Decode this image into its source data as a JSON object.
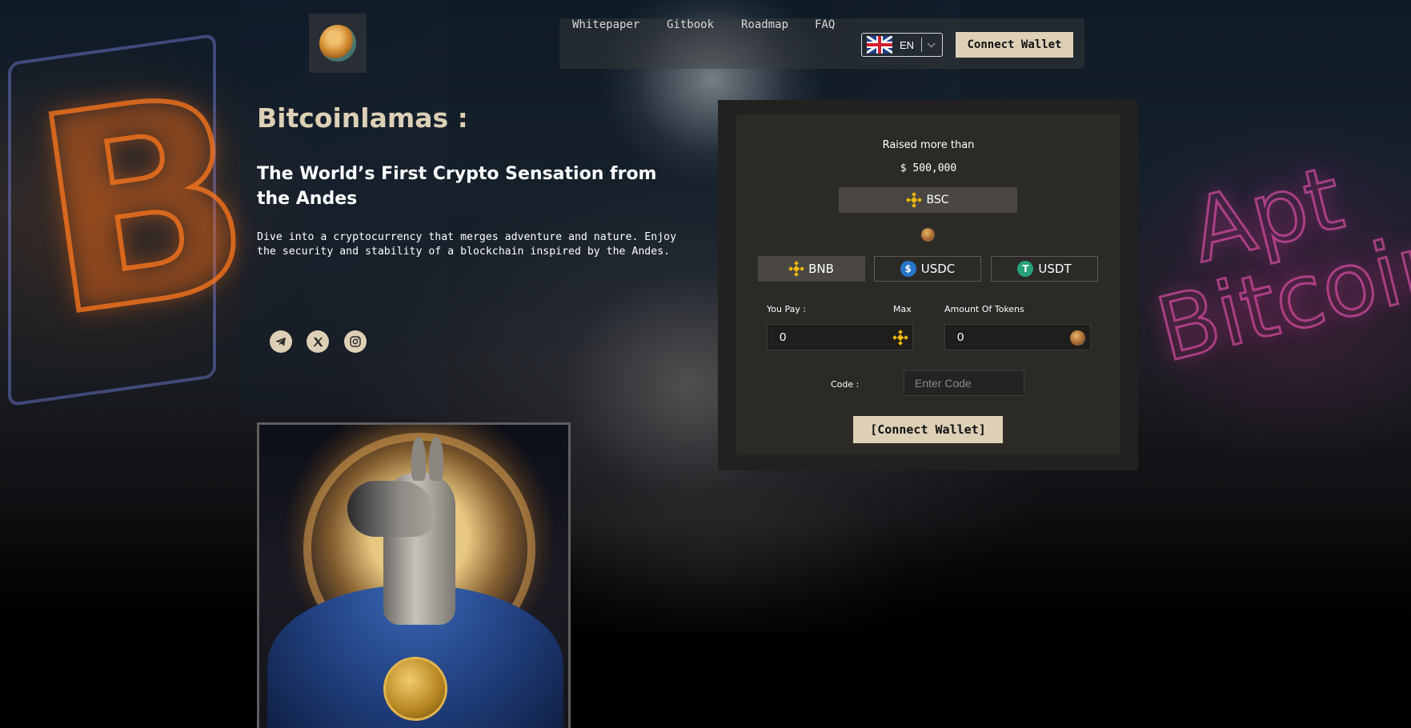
{
  "header": {
    "logo_alt": "Bitcoinlamas logo",
    "nav": [
      "Whitepaper",
      "Gitbook",
      "Roadmap",
      "FAQ"
    ],
    "language": "EN",
    "connect_label": "Connect Wallet"
  },
  "hero": {
    "title": "Bitcoinlamas :",
    "subtitle": "The World’s First Crypto Sensation from the Andes",
    "description": "Dive into a cryptocurrency that merges adventure and nature. Enjoy the security and stability of a blockchain inspired by the Andes.",
    "socials": [
      {
        "icon": "telegram-icon"
      },
      {
        "icon": "x-twitter-icon"
      },
      {
        "icon": "instagram-icon"
      }
    ]
  },
  "presale": {
    "raised_label": "Raised more than",
    "raised_amount": "$ 500,000",
    "network": "BSC",
    "currencies": [
      "BNB",
      "USDC",
      "USDT"
    ],
    "active_currency": "BNB",
    "pay_label": "You Pay :",
    "max_label": "Max",
    "pay_value": "0",
    "tokens_label": "Amount Of Tokens",
    "tokens_value": "0",
    "code_label": "Code :",
    "code_placeholder": "Enter Code",
    "connect_label": "[Connect Wallet]"
  },
  "colors": {
    "accent": "#ddd0b6",
    "card_bg": "#2c2a27",
    "card_outer": "#222120",
    "bnb": "#f0b90b",
    "usdc": "#2775ca",
    "usdt": "#26a17b"
  }
}
